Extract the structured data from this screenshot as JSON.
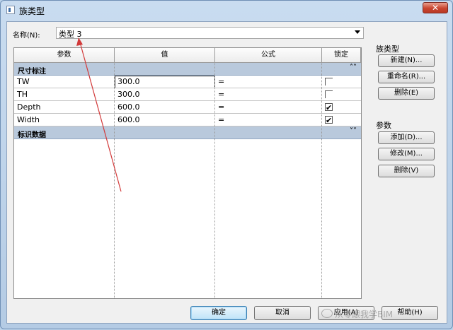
{
  "window": {
    "title": "族类型",
    "close_label": "✕"
  },
  "name_field": {
    "label": "名称(N):",
    "value": "类型 3"
  },
  "grid": {
    "columns": [
      "参数",
      "值",
      "公式",
      "锁定"
    ],
    "groups": [
      {
        "label": "尺寸标注",
        "chevron": "˄˄",
        "rows": [
          {
            "param": "TW",
            "value": "300.0",
            "formula": "=",
            "locked": false
          },
          {
            "param": "TH",
            "value": "300.0",
            "formula": "=",
            "locked": false
          },
          {
            "param": "Depth",
            "value": "600.0",
            "formula": "=",
            "locked": true
          },
          {
            "param": "Width",
            "value": "600.0",
            "formula": "=",
            "locked": true
          }
        ]
      },
      {
        "label": "标识数据",
        "chevron": "˅˅",
        "rows": []
      }
    ]
  },
  "family_types": {
    "label": "族类型",
    "new_button": "新建(N)...",
    "rename_button": "重命名(R)...",
    "delete_button": "删除(E)"
  },
  "parameters": {
    "label": "参数",
    "add_button": "添加(D)...",
    "modify_button": "修改(M)...",
    "delete_button": "删除(V)"
  },
  "footer": {
    "ok_button": "确定",
    "cancel_button": "取消",
    "apply_button": "应用(A)",
    "help_button": "帮助(H)"
  },
  "watermark": "从零跟我学BIM"
}
